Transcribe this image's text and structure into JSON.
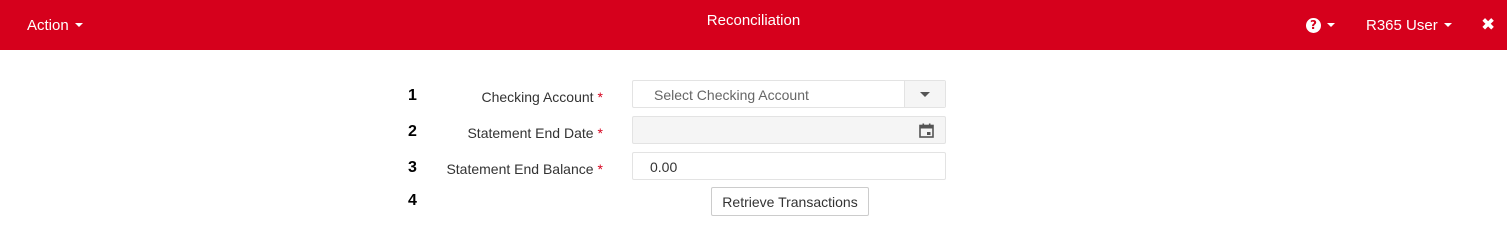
{
  "topbar": {
    "action_label": "Action",
    "title": "Reconciliation",
    "help_symbol": "?",
    "user_label": "R365 User",
    "close_symbol": "✖",
    "bg_color": "#d6001c"
  },
  "form": {
    "steps": [
      {
        "number": "1",
        "label": "Checking Account",
        "required": "*"
      },
      {
        "number": "2",
        "label": "Statement End Date",
        "required": "*"
      },
      {
        "number": "3",
        "label": "Statement End Balance",
        "required": "*"
      },
      {
        "number": "4"
      }
    ],
    "checking_account": {
      "placeholder": "Select Checking Account"
    },
    "statement_end_date": {
      "value": ""
    },
    "statement_end_balance": {
      "value": "0.00"
    },
    "retrieve_button_label": "Retrieve Transactions"
  }
}
